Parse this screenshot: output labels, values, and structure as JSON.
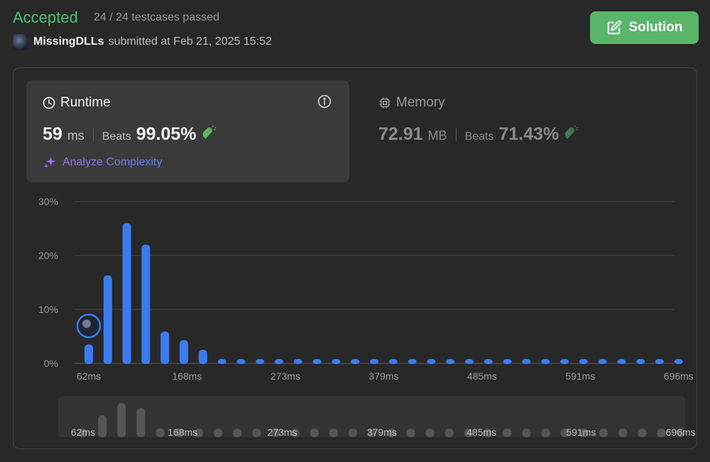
{
  "header": {
    "status": "Accepted",
    "testcases": "24 / 24 testcases passed",
    "username": "MissingDLLs",
    "submitted": "submitted at Feb 21, 2025 15:52",
    "solution_label": "Solution"
  },
  "runtime": {
    "title": "Runtime",
    "value": "59",
    "unit": "ms",
    "beats_label": "Beats",
    "beats_value": "99.05%",
    "analyze_label": "Analyze Complexity"
  },
  "memory": {
    "title": "Memory",
    "value": "72.91",
    "unit": "MB",
    "beats_label": "Beats",
    "beats_value": "71.43%"
  },
  "colors": {
    "accepted": "#4cc16a",
    "bar": "#3a7cf0",
    "mini_bar": "#555555",
    "analyze_start": "#a16ff2",
    "analyze_end": "#5b83f5"
  },
  "chart_data": {
    "type": "bar",
    "y_ticks": [
      "30%",
      "20%",
      "10%",
      "0%"
    ],
    "ylim": [
      0,
      30
    ],
    "x_tick_labels": [
      "62ms",
      "168ms",
      "273ms",
      "379ms",
      "485ms",
      "591ms",
      "696ms"
    ],
    "values": [
      3.5,
      16.3,
      26.0,
      22.0,
      5.9,
      4.3,
      2.5,
      0.8,
      0.8,
      0.8,
      0.8,
      0.8,
      0.8,
      0.8,
      0.8,
      0.8,
      0.8,
      0.8,
      0.8,
      0.8,
      0.8,
      0.8,
      0.8,
      0.8,
      0.8,
      0.8,
      0.8,
      0.8,
      0.8,
      0.8,
      0.8,
      0.8
    ],
    "user_bar_index": 0,
    "user_marker_value": 8.0,
    "grid": true
  }
}
